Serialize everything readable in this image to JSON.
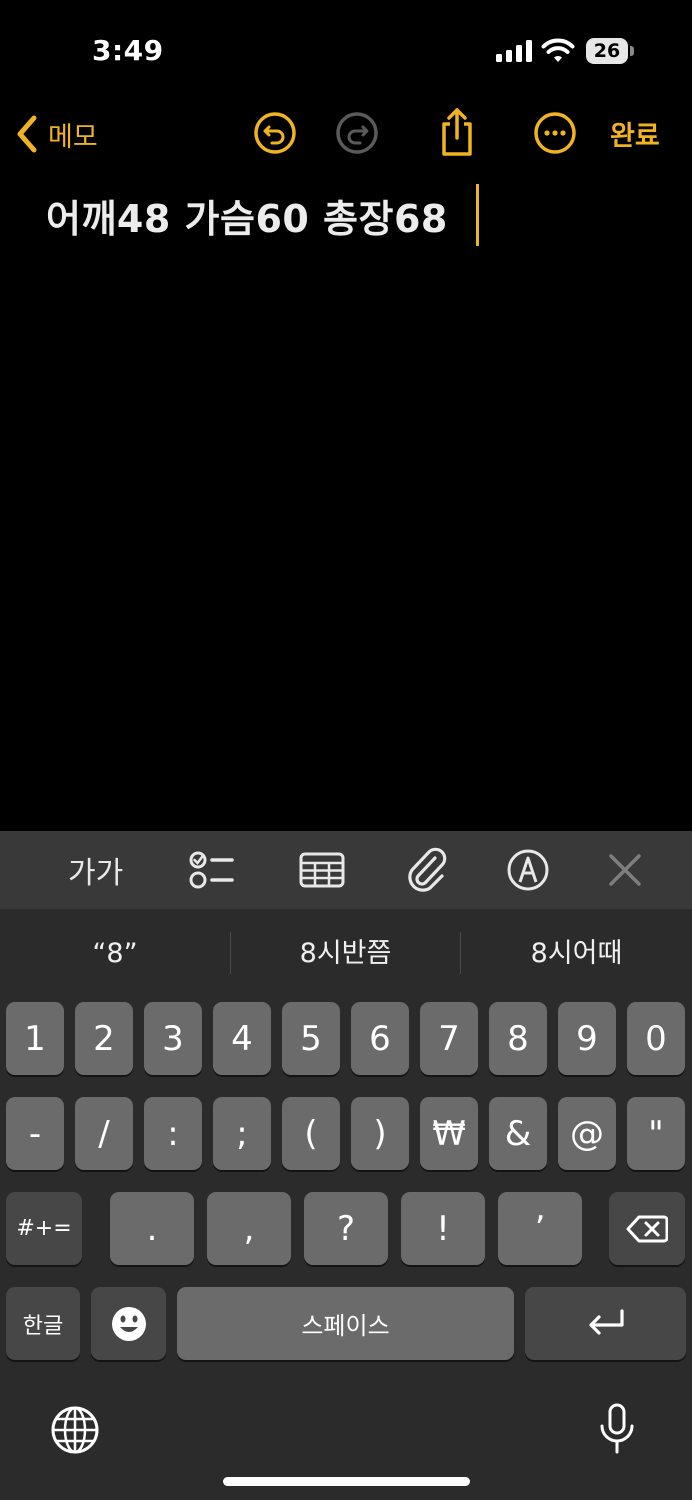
{
  "status_bar": {
    "time": "3:49",
    "battery_level": "26"
  },
  "nav": {
    "back_label": "메모",
    "done_label": "완료"
  },
  "note": {
    "text": "어깨48 가슴60 총장68"
  },
  "toolbar": {
    "format_label": "가가"
  },
  "suggestions": [
    "“8”",
    "8시반쯤",
    "8시어때"
  ],
  "keyboard": {
    "row1": [
      "1",
      "2",
      "3",
      "4",
      "5",
      "6",
      "7",
      "8",
      "9",
      "0"
    ],
    "row2": [
      "-",
      "/",
      ":",
      ";",
      "(",
      ")",
      "₩",
      "&",
      "@",
      "\""
    ],
    "row3": [
      "#+=",
      ".",
      ",",
      "?",
      "!",
      "’"
    ],
    "lang_label": "한글",
    "space_label": "스페이스"
  },
  "colors": {
    "accent": "#f0b321",
    "background": "#000000",
    "key": "#6b6b6b",
    "key_dark": "#474747"
  }
}
